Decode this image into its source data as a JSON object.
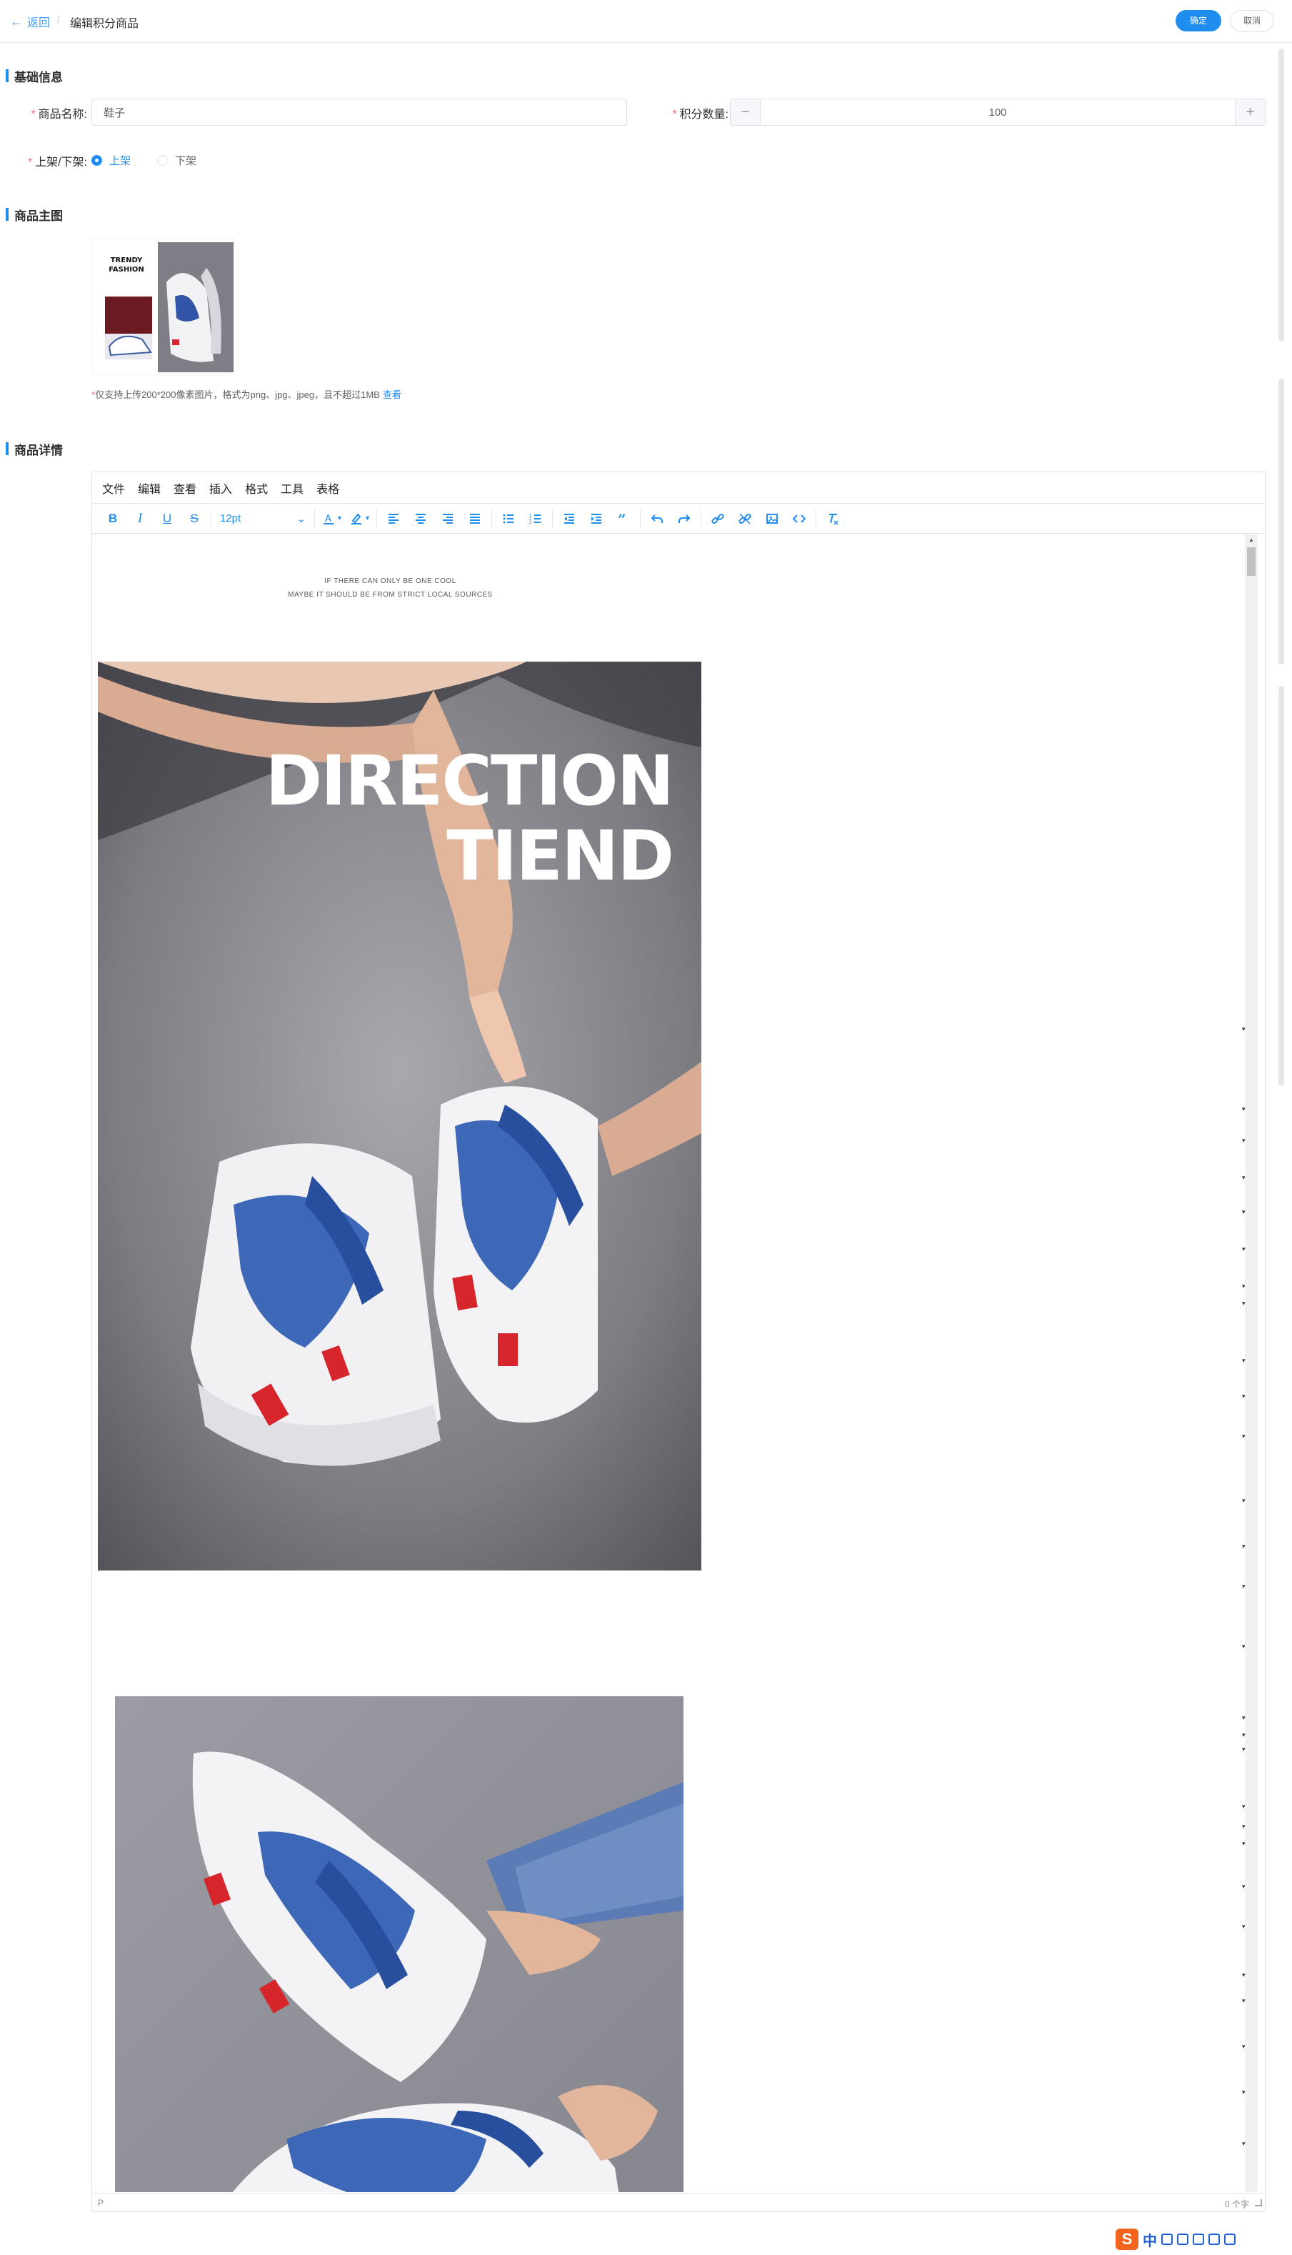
{
  "header": {
    "back_label": "返回",
    "separator": "/",
    "title": "编辑积分商品",
    "confirm_label": "确定",
    "cancel_label": "取消"
  },
  "sections": {
    "basic": "基础信息",
    "main_image": "商品主图",
    "detail": "商品详情"
  },
  "form": {
    "name_label": "商品名称:",
    "name_value": "鞋子",
    "points_label": "积分数量:",
    "points_value": "100",
    "status_label": "上架/下架:",
    "status_options": [
      "上架",
      "下架"
    ],
    "status_selected": "上架"
  },
  "main_image": {
    "logo_text_line1": "TRENDY",
    "logo_text_line2": "FASHION",
    "hint": "仅支持上传200*200像素图片，格式为png、jpg、jpeg，且不超过1MB",
    "hint_link": "查看"
  },
  "editor": {
    "menu": [
      "文件",
      "编辑",
      "查看",
      "插入",
      "格式",
      "工具",
      "表格"
    ],
    "font_size": "12pt",
    "tagline_1": "IF THERE CAN ONLY BE ONE COOL",
    "tagline_2": "MAYBE IT SHOULD BE FROM STRICT LOCAL SOURCES",
    "photo_headline_1": "DIRECTION",
    "photo_headline_2": "TIEND",
    "status_path": "P",
    "word_count": "0 个字"
  },
  "icons": {
    "bold": "B",
    "italic": "I",
    "underline": "U",
    "strike": "S"
  },
  "colors": {
    "accent": "#1f8cf0",
    "required": "#f56c6c"
  }
}
